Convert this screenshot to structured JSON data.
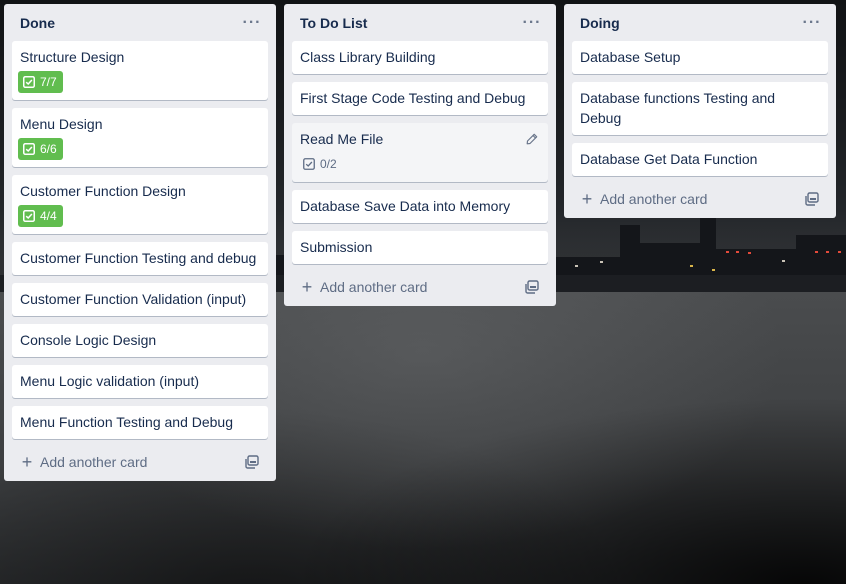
{
  "board": {
    "lists": [
      {
        "title": "Done",
        "menu_icon": "ellipsis-icon",
        "add_card_label": "Add another card",
        "cards": [
          {
            "title": "Structure Design",
            "checklist": "7/7",
            "complete": true
          },
          {
            "title": "Menu Design",
            "checklist": "6/6",
            "complete": true
          },
          {
            "title": "Customer Function Design",
            "checklist": "4/4",
            "complete": true
          },
          {
            "title": "Customer Function Testing and debug"
          },
          {
            "title": "Customer Function Validation (input)"
          },
          {
            "title": "Console Logic Design"
          },
          {
            "title": "Menu Logic validation (input)"
          },
          {
            "title": "Menu Function Testing and Debug"
          }
        ]
      },
      {
        "title": "To Do List",
        "menu_icon": "ellipsis-icon",
        "add_card_label": "Add another card",
        "cards": [
          {
            "title": "Class Library Building"
          },
          {
            "title": "First Stage Code Testing and Debug"
          },
          {
            "title": "Read Me File",
            "checklist": "0/2",
            "complete": false,
            "hover": true
          },
          {
            "title": "Database Save Data into Memory"
          },
          {
            "title": "Submission"
          }
        ]
      },
      {
        "title": "Doing",
        "menu_icon": "ellipsis-icon",
        "add_card_label": "Add another card",
        "cards": [
          {
            "title": "Database Setup"
          },
          {
            "title": "Database functions Testing and Debug"
          },
          {
            "title": "Database Get Data Function"
          }
        ]
      }
    ]
  },
  "colors": {
    "list_bg": "#ebecf0",
    "card_bg": "#ffffff",
    "complete_badge": "#61bd4f",
    "text_primary": "#172b4d",
    "text_secondary": "#5e6c84"
  }
}
